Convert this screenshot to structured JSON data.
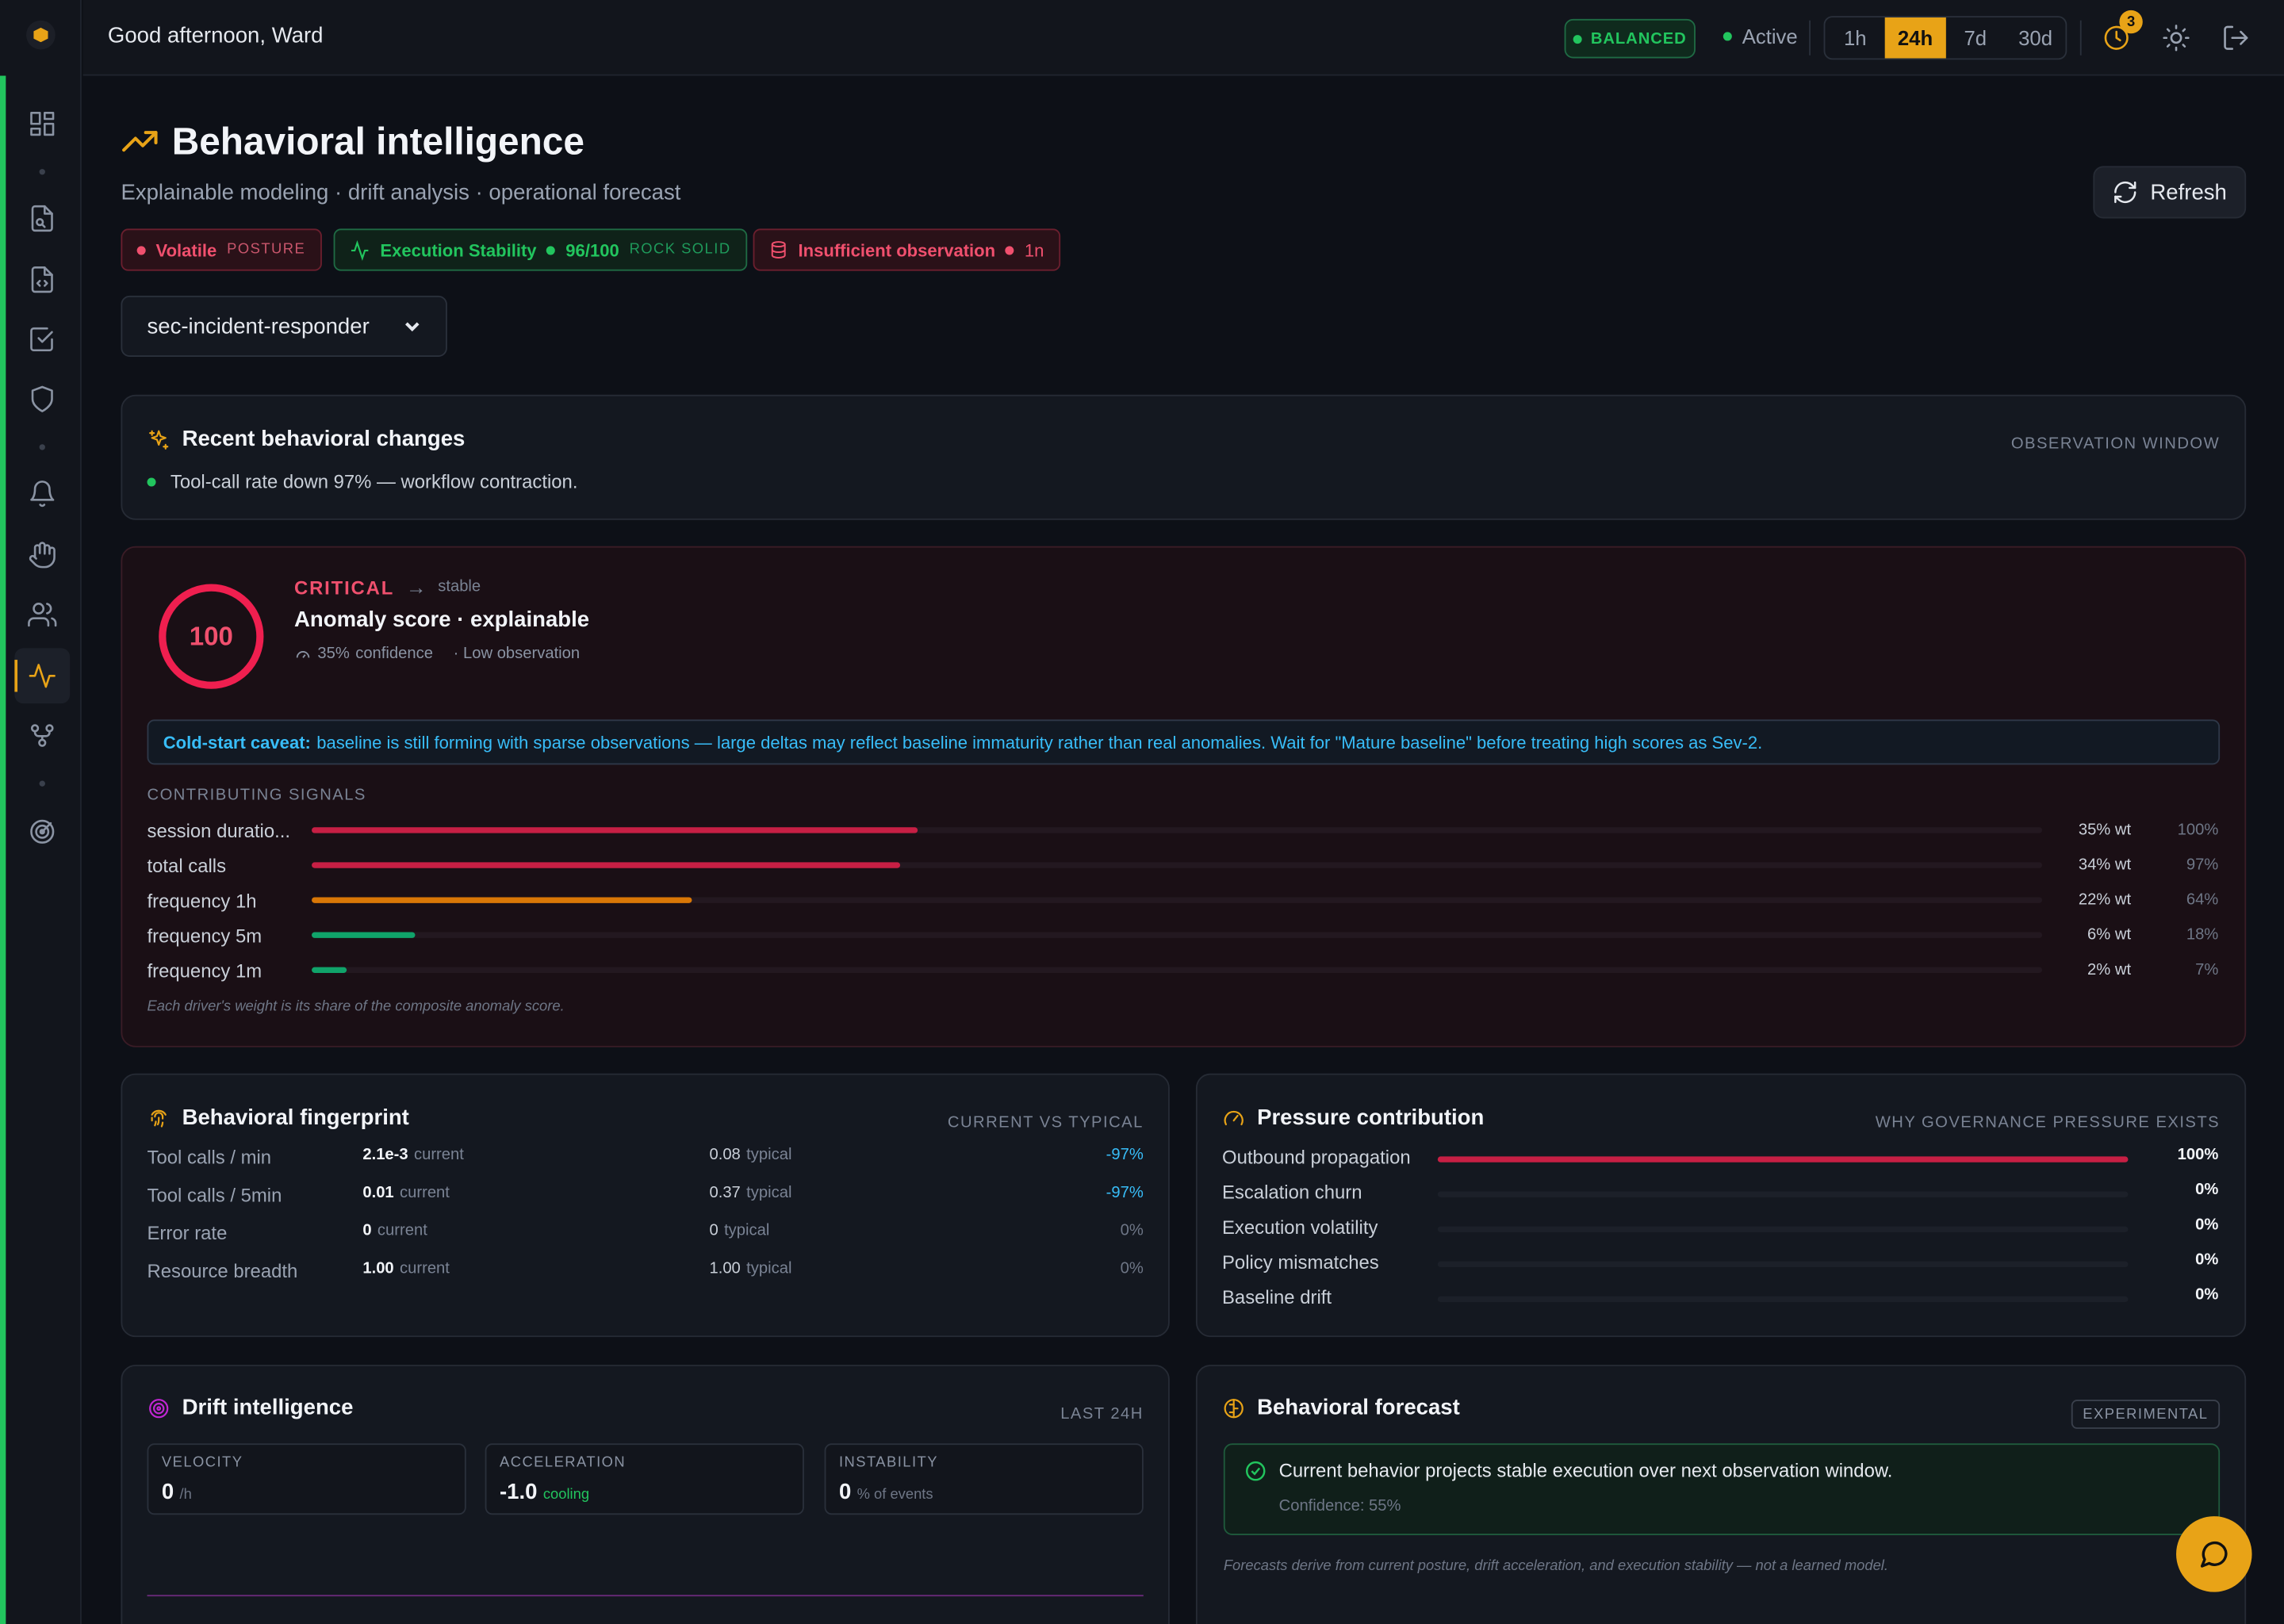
{
  "header": {
    "greeting": "Good afternoon, Ward",
    "mode_badge": "BALANCED",
    "status": "Active",
    "time_ranges": [
      "1h",
      "24h",
      "7d",
      "30d"
    ],
    "selected_range": "24h",
    "notification_count": "3"
  },
  "page": {
    "title": "Behavioral intelligence",
    "subtitle": "Explainable modeling · drift analysis · operational forecast",
    "refresh_label": "Refresh",
    "chips": {
      "posture_value": "Volatile",
      "posture_label": "POSTURE",
      "stability_label": "Execution Stability",
      "stability_score": "96/100",
      "stability_grade": "ROCK SOLID",
      "observation_label": "Insufficient observation",
      "observation_count": "1n"
    },
    "agent_select": "sec-incident-responder"
  },
  "recent_changes": {
    "title": "Recent behavioral changes",
    "tag": "OBSERVATION WINDOW",
    "item": "Tool-call rate down 97% — workflow contraction."
  },
  "anomaly": {
    "score": "100",
    "severity": "CRITICAL",
    "arrow": "→",
    "trend": "stable",
    "title": "Anomaly score · explainable",
    "confidence": "35%",
    "confidence_suffix": "confidence",
    "observation": "· Low observation",
    "caveat_title": "Cold-start caveat:",
    "caveat_text": "baseline is still forming with sparse observations — large deltas may reflect baseline immaturity rather than real anomalies. Wait for \"Mature baseline\" before treating high scores as Sev-2.",
    "signals_heading": "CONTRIBUTING SIGNALS",
    "signals": [
      {
        "label": "session duratio...",
        "weight": "35% wt",
        "pct": "100%",
        "fill": 0.35,
        "color": "#c71f44"
      },
      {
        "label": "total calls",
        "weight": "34% wt",
        "pct": "97%",
        "fill": 0.34,
        "color": "#c71f44"
      },
      {
        "label": "frequency 1h",
        "weight": "22% wt",
        "pct": "64%",
        "fill": 0.22,
        "color": "#d97706"
      },
      {
        "label": "frequency 5m",
        "weight": "6% wt",
        "pct": "18%",
        "fill": 0.06,
        "color": "#10a36a"
      },
      {
        "label": "frequency 1m",
        "weight": "2% wt",
        "pct": "7%",
        "fill": 0.02,
        "color": "#10a36a"
      }
    ],
    "footnote": "Each driver's weight is its share of the composite anomaly score."
  },
  "fingerprint": {
    "title": "Behavioral fingerprint",
    "tag": "CURRENT VS TYPICAL",
    "current_suffix": "current",
    "typical_suffix": "typical",
    "rows": [
      {
        "label": "Tool calls / min",
        "current": "2.1e-3",
        "typical": "0.08",
        "delta": "-97%"
      },
      {
        "label": "Tool calls / 5min",
        "current": "0.01",
        "typical": "0.37",
        "delta": "-97%"
      },
      {
        "label": "Error rate",
        "current": "0",
        "typical": "0",
        "delta": "0%"
      },
      {
        "label": "Resource breadth",
        "current": "1.00",
        "typical": "1.00",
        "delta": "0%"
      }
    ]
  },
  "pressure": {
    "title": "Pressure contribution",
    "tag": "WHY GOVERNANCE PRESSURE EXISTS",
    "rows": [
      {
        "label": "Outbound propagation",
        "value": "100%",
        "fill": 1.0
      },
      {
        "label": "Escalation churn",
        "value": "0%",
        "fill": 0
      },
      {
        "label": "Execution volatility",
        "value": "0%",
        "fill": 0
      },
      {
        "label": "Policy mismatches",
        "value": "0%",
        "fill": 0
      },
      {
        "label": "Baseline drift",
        "value": "0%",
        "fill": 0
      }
    ]
  },
  "drift": {
    "title": "Drift intelligence",
    "tag": "LAST 24H",
    "metrics": [
      {
        "label": "VELOCITY",
        "value": "0",
        "unit": "/h"
      },
      {
        "label": "ACCELERATION",
        "value": "-1.0",
        "unit": "cooling"
      },
      {
        "label": "INSTABILITY",
        "value": "0",
        "unit": "% of events"
      }
    ]
  },
  "forecast": {
    "title": "Behavioral forecast",
    "tag": "EXPERIMENTAL",
    "message": "Current behavior projects stable execution over next observation window.",
    "confidence": "Confidence: 55%",
    "footnote": "Forecasts derive from current posture, drift acceleration, and execution stability — not a learned model."
  },
  "colors": {
    "accent": "#e8a317",
    "critical": "#f0506e",
    "ok": "#22c55e",
    "info": "#38bdf8"
  }
}
